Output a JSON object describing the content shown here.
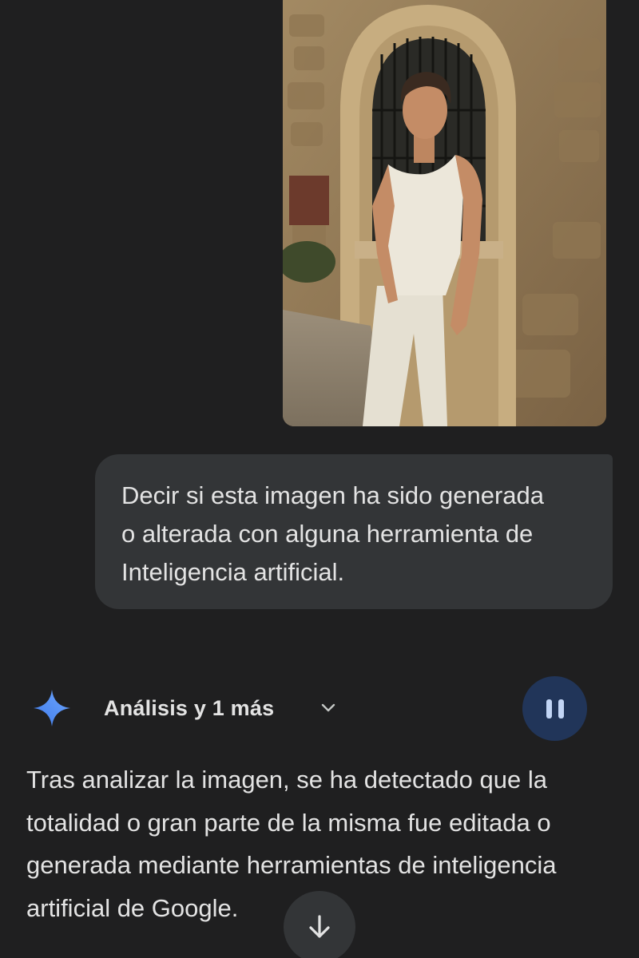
{
  "conversation": {
    "attachment": {
      "icon": "attached-photo"
    },
    "user_message": {
      "text": "Decir si esta imagen ha sido generada\no alterada con alguna herramienta de\nInteligencia artificial."
    },
    "response": {
      "icon": "gemini-sparkle-icon",
      "tools_label": "Análisis y 1 más",
      "tools_icon": "chevron-down-icon",
      "pause_icon": "pause-icon",
      "text": "Tras analizar la imagen, se ha detectado que la\ntotalidad o gran parte de la misma fue editada o\ngenerada mediante herramientas de inteligencia\nartificial de Google."
    },
    "scroll_button": {
      "icon": "arrow-down-icon"
    }
  },
  "colors": {
    "background": "#1f1f20",
    "bubble": "#333537",
    "text": "#e3e3e3",
    "pause_button": "#213559",
    "pause_glyph": "#c2d5f5",
    "gemini_blue": "#4a8cf5"
  }
}
